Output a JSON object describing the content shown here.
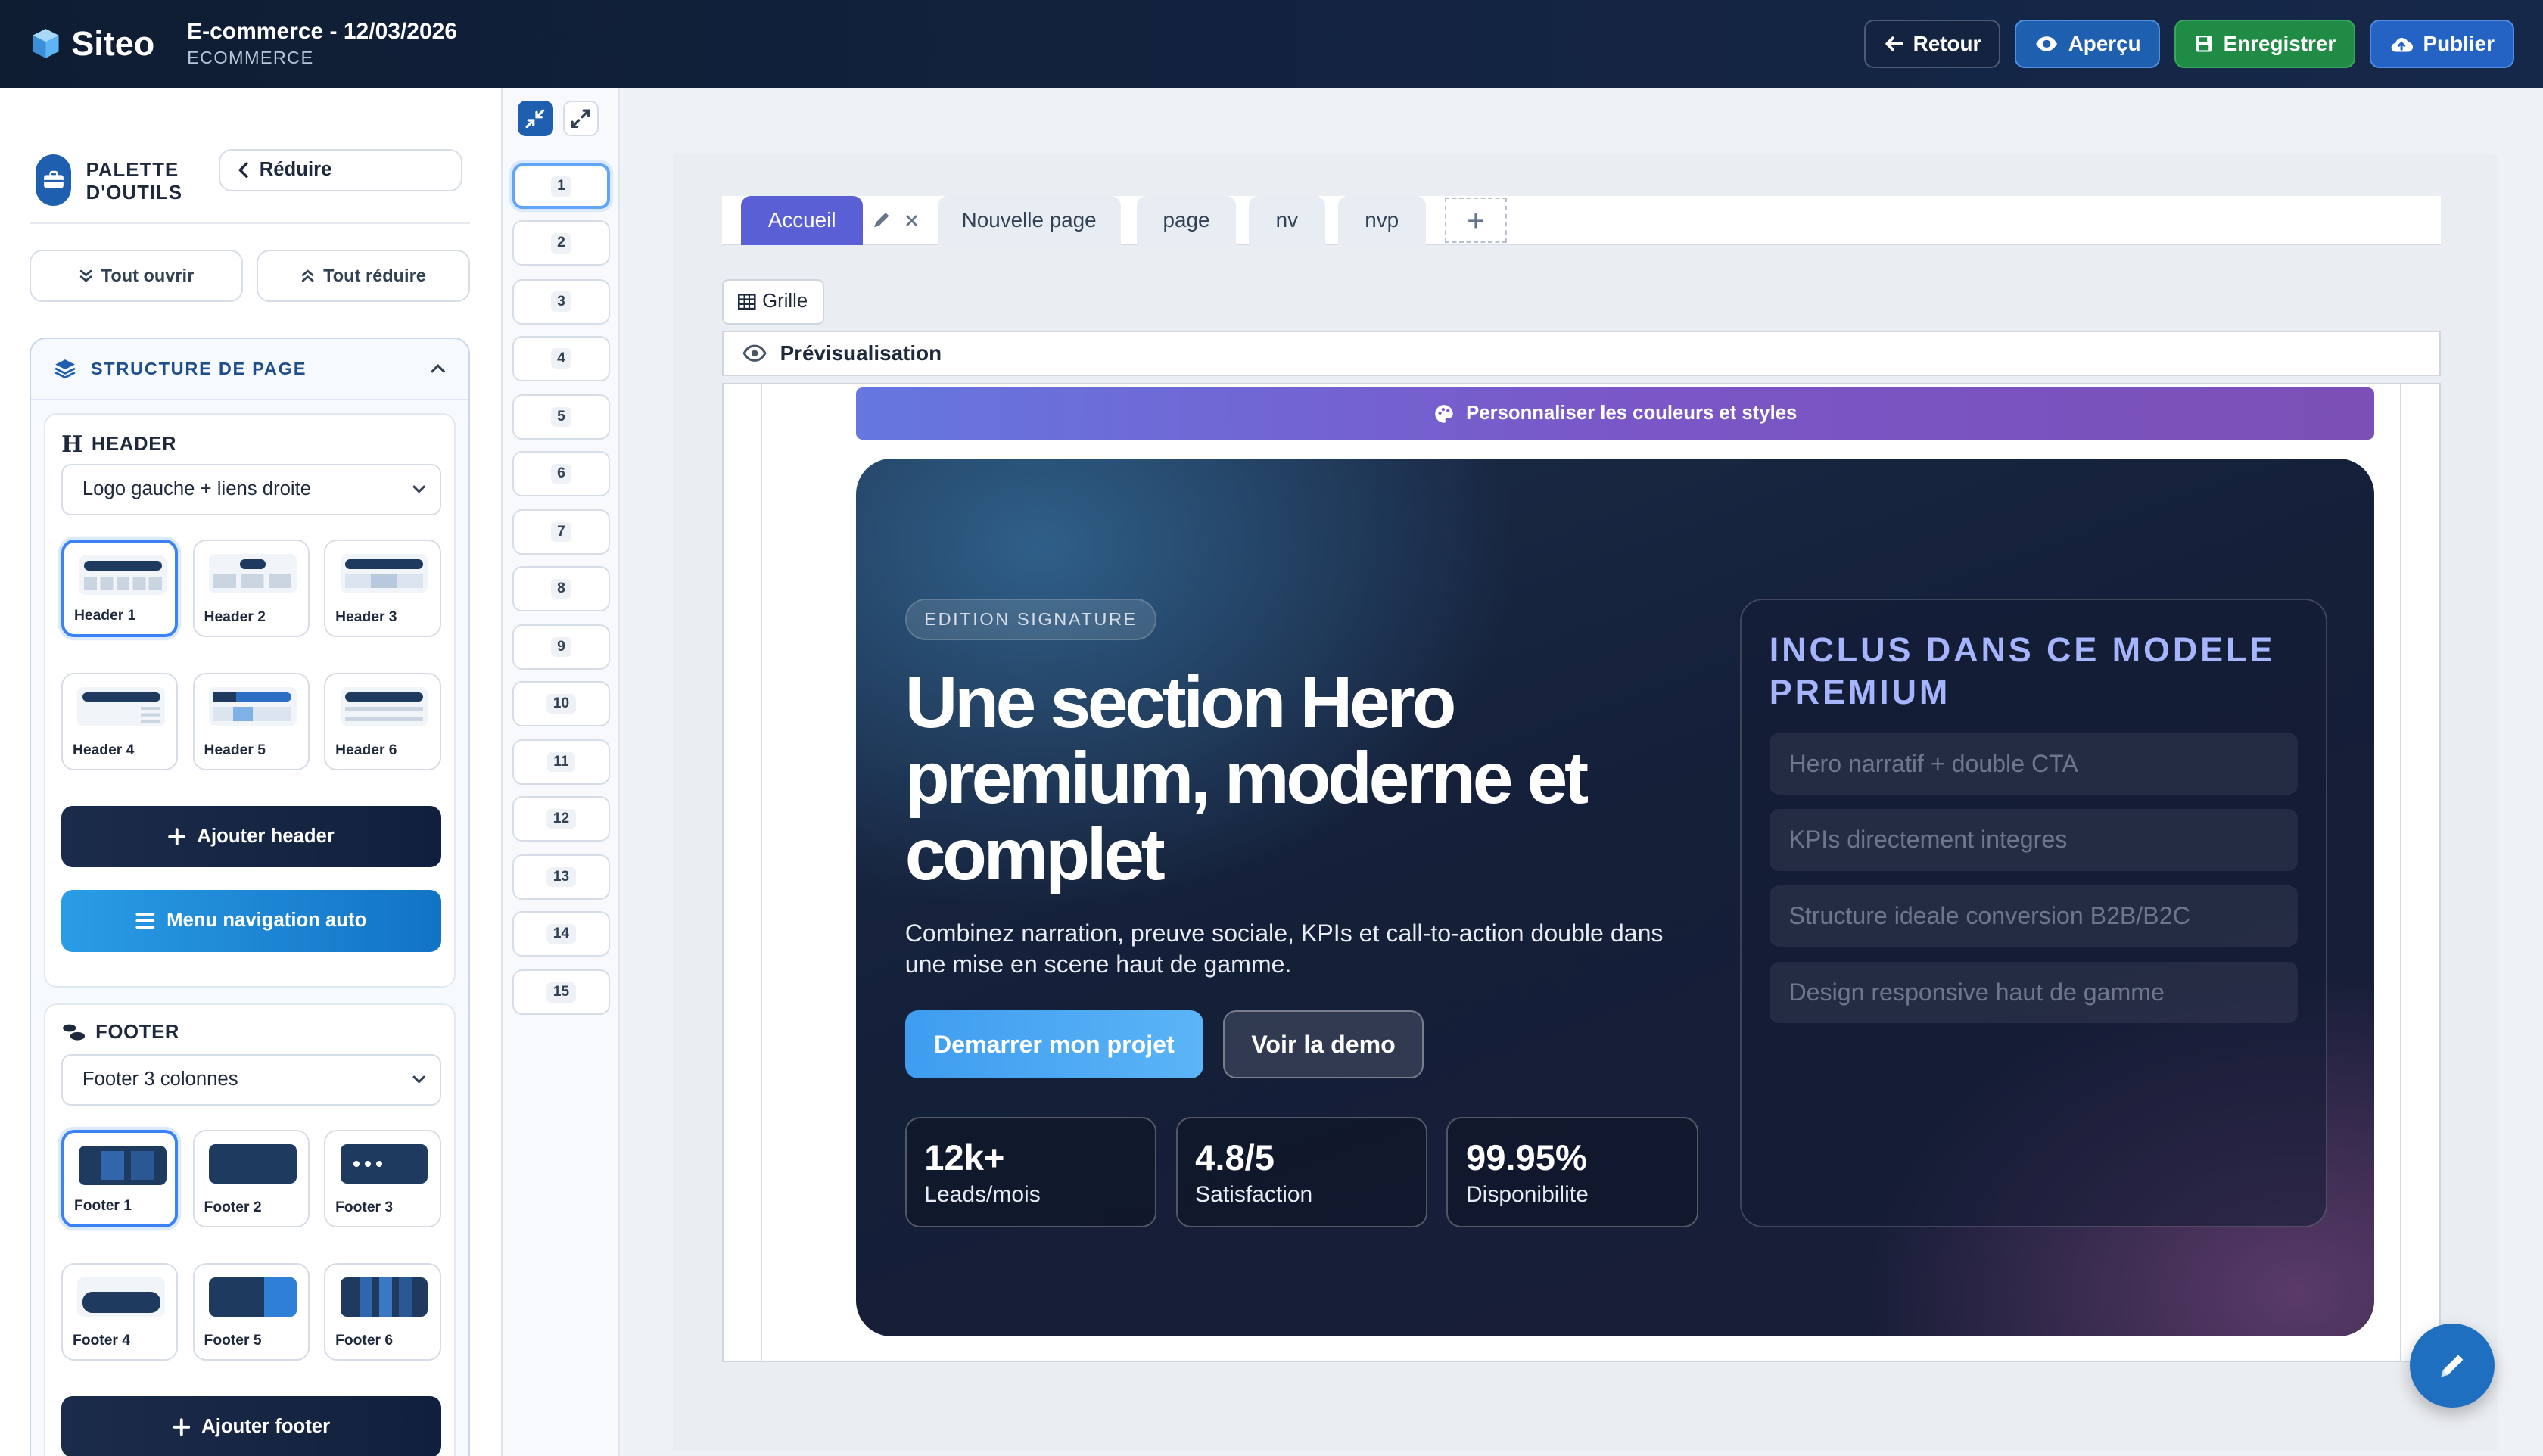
{
  "topbar": {
    "brand": "Siteo",
    "doc_title": "E-commerce - 12/03/2026",
    "doc_subtitle": "ECOMMERCE",
    "actions": {
      "retour": "Retour",
      "apercu": "Aperçu",
      "enregistrer": "Enregistrer",
      "publier": "Publier"
    }
  },
  "palette": {
    "title_line1": "PALETTE",
    "title_line2": "D'OUTILS",
    "reduire": "Réduire",
    "tout_ouvrir": "Tout ouvrir",
    "tout_reduire": "Tout réduire",
    "structure_title": "STRUCTURE DE PAGE",
    "header": {
      "label": "HEADER",
      "selected": "Logo gauche + liens droite",
      "tiles": [
        "Header 1",
        "Header 2",
        "Header 3",
        "Header 4",
        "Header 5",
        "Header 6"
      ],
      "add_button": "Ajouter header",
      "nav_button": "Menu navigation auto"
    },
    "footer": {
      "label": "FOOTER",
      "selected": "Footer 3 colonnes",
      "tiles": [
        "Footer 1",
        "Footer 2",
        "Footer 3",
        "Footer 4",
        "Footer 5",
        "Footer 6"
      ],
      "add_button": "Ajouter footer"
    }
  },
  "pages": [
    "1",
    "2",
    "3",
    "4",
    "5",
    "6",
    "7",
    "8",
    "9",
    "10",
    "11",
    "12",
    "13",
    "14",
    "15"
  ],
  "tabs": [
    "Accueil",
    "Nouvelle page",
    "page",
    "nv",
    "nvp"
  ],
  "toolbar": {
    "grille": "Grille",
    "previsualisation": "Prévisualisation",
    "customize": "Personnaliser les couleurs et styles"
  },
  "hero": {
    "eyebrow": "EDITION SIGNATURE",
    "title": "Une section Hero premium, moderne et complet",
    "text": "Combinez narration, preuve sociale, KPIs et call-to-action double dans une mise en scene haut de gamme.",
    "cta_primary": "Demarrer mon projet",
    "cta_secondary": "Voir la demo",
    "kpis": [
      {
        "value": "12k+",
        "label": "Leads/mois"
      },
      {
        "value": "4.8/5",
        "label": "Satisfaction"
      },
      {
        "value": "99.95%",
        "label": "Disponibilite"
      }
    ],
    "included": {
      "title": "INCLUS DANS CE MODELE PREMIUM",
      "items": [
        "Hero narratif + double CTA",
        "KPIs directement integres",
        "Structure ideale conversion B2B/B2C",
        "Design responsive haut de gamme"
      ]
    }
  },
  "colors": {
    "topbar": "#0f1d33",
    "accent_tab": "#5b5fd6",
    "save_green": "#1f8b44",
    "publish_blue": "#2463c4"
  }
}
